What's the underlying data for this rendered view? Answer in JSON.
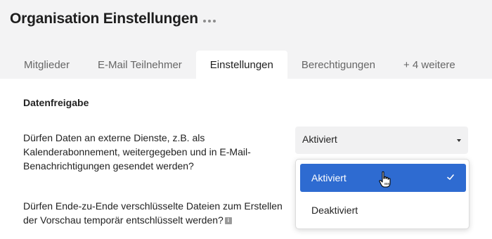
{
  "header": {
    "title": "Organisation Einstellungen",
    "more_icon": "more-horizontal-icon"
  },
  "tabs": [
    {
      "label": "Mitglieder",
      "active": false
    },
    {
      "label": "E-Mail Teilnehmer",
      "active": false
    },
    {
      "label": "Einstellungen",
      "active": true
    },
    {
      "label": "Berechtigungen",
      "active": false
    },
    {
      "label": "+ 4 weitere",
      "active": false
    }
  ],
  "section": {
    "title": "Datenfreigabe"
  },
  "settings": {
    "q1": "Dürfen Daten an externe Dienste, z.B. als Kalenderabonnement, weitergegeben und in E-Mail-Benachrichtigungen gesendet werden?",
    "q2": "Dürfen Ende-zu-Ende verschlüsselte Dateien zum Erstellen der Vorschau temporär entschlüsselt werden?",
    "q2_info_icon": "info-icon"
  },
  "select": {
    "value": "Aktiviert",
    "options": [
      {
        "label": "Aktiviert",
        "selected": true
      },
      {
        "label": "Deaktiviert",
        "selected": false
      }
    ]
  },
  "colors": {
    "accent": "#2e6bd1",
    "header_bg": "#f3f3f4"
  }
}
